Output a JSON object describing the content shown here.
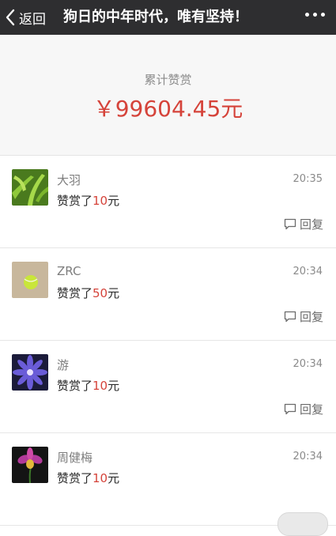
{
  "topbar": {
    "back_label": "返回",
    "title": "狗日的中年时代，唯有坚持！"
  },
  "summary": {
    "label": "累计赞赏",
    "total": "￥99604.45元"
  },
  "rewards": [
    {
      "name": "大羽",
      "time": "20:35",
      "prefix": "赞赏了",
      "amount": "10",
      "suffix": "元",
      "reply": "回复"
    },
    {
      "name": "ZRC",
      "time": "20:34",
      "prefix": "赞赏了",
      "amount": "50",
      "suffix": "元",
      "reply": "回复"
    },
    {
      "name": "游",
      "time": "20:34",
      "prefix": "赞赏了",
      "amount": "10",
      "suffix": "元",
      "reply": "回复"
    },
    {
      "name": "周健梅",
      "time": "20:34",
      "prefix": "赞赏了",
      "amount": "10",
      "suffix": "元"
    }
  ],
  "colors": {
    "accent": "#d5433a",
    "topbar": "#2e2e30"
  }
}
